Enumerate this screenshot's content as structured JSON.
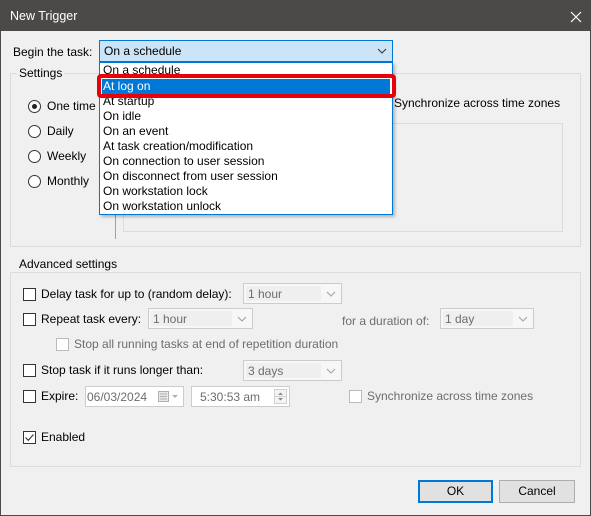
{
  "window": {
    "title": "New Trigger",
    "close_icon": "close-icon"
  },
  "begin_task": {
    "label": "Begin the task:",
    "selected": "On a schedule",
    "dropdown_open": true,
    "options": [
      "On a schedule",
      "At log on",
      "At startup",
      "On idle",
      "On an event",
      "At task creation/modification",
      "On connection to user session",
      "On disconnect from user session",
      "On workstation lock",
      "On workstation unlock"
    ],
    "highlighted_option": "At log on",
    "annotation_color": "#e8000b",
    "selection_color": "#0078d7"
  },
  "settings": {
    "title": "Settings",
    "frequency": [
      {
        "label": "One time",
        "checked": true
      },
      {
        "label": "Daily",
        "checked": false
      },
      {
        "label": "Weekly",
        "checked": false
      },
      {
        "label": "Monthly",
        "checked": false
      }
    ],
    "sync_label": "Synchronize across time zones"
  },
  "advanced": {
    "title": "Advanced settings",
    "delay": {
      "label": "Delay task for up to (random delay):",
      "checked": false,
      "value": "1 hour"
    },
    "repeat": {
      "label": "Repeat task every:",
      "checked": false,
      "value": "1 hour",
      "duration_label": "for a duration of:",
      "duration_value": "1 day"
    },
    "stop_all": {
      "label": "Stop all running tasks at end of repetition duration",
      "checked": false
    },
    "stop_longer": {
      "label": "Stop task if it runs longer than:",
      "checked": false,
      "value": "3 days"
    },
    "expire": {
      "label": "Expire:",
      "checked": false,
      "date": "06/03/2024",
      "time": "5:30:53 am",
      "sync_label": "Synchronize across time zones",
      "sync_checked": false
    },
    "enabled": {
      "label": "Enabled",
      "checked": true
    }
  },
  "buttons": {
    "ok": "OK",
    "cancel": "Cancel"
  }
}
